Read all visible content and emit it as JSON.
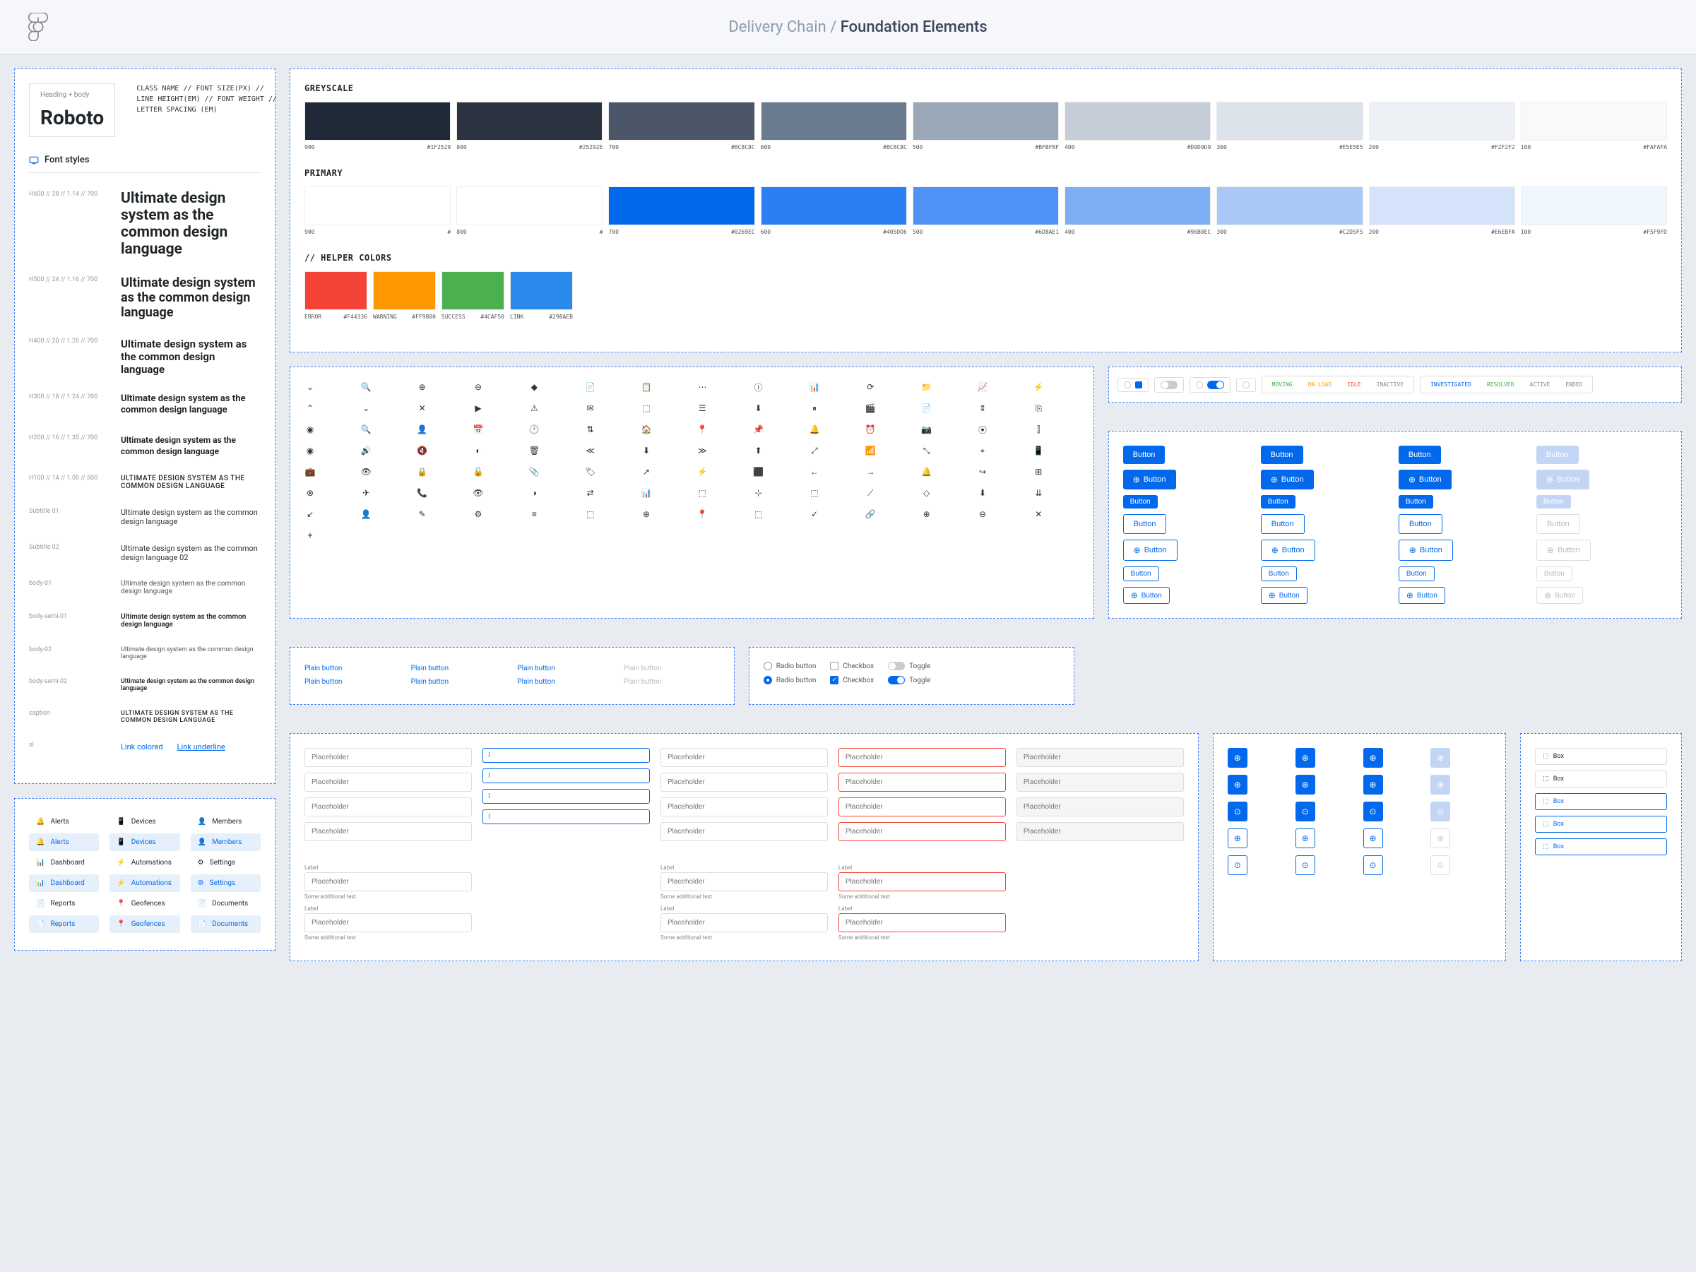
{
  "header": {
    "path": "Delivery Chain /",
    "title": "Foundation Elements"
  },
  "typography": {
    "box_label": "Heading + body",
    "font_name": "Roboto",
    "class_desc": "CLASS NAME // FONT SIZE(PX) //\nLINE HEIGHT(EM) // FONT WEIGHT //\nLETTER SPACING (EM)",
    "section_title": "Font styles",
    "sample": "Ultimate design system as the common design language",
    "sample_caps": "ULTIMATE DESIGN SYSTEM AS THE COMMON DESIGN LANGUAGE",
    "sample2": "Ultimate design system as the common design language 02",
    "styles": [
      {
        "label": "H600 // 28 // 1.14 // 700",
        "cls": "h600"
      },
      {
        "label": "H500 // 24 // 1.16 // 700",
        "cls": "h500"
      },
      {
        "label": "H400 // 20 // 1.20 // 700",
        "cls": "h400"
      },
      {
        "label": "H300 // 18 // 1.24 // 700",
        "cls": "h300"
      },
      {
        "label": "H200 // 16 // 1.35 // 700",
        "cls": "h200"
      },
      {
        "label": "H100 // 14 // 1.00 // 500",
        "cls": "h100"
      },
      {
        "label": "Subtitle 01",
        "cls": "st"
      },
      {
        "label": "Subtitle 02",
        "cls": "st"
      },
      {
        "label": "body-01",
        "cls": "b1"
      },
      {
        "label": "body-semi-01",
        "cls": "b1s"
      },
      {
        "label": "body-02",
        "cls": "b2"
      },
      {
        "label": "body-semi-02",
        "cls": "b2s"
      },
      {
        "label": "caption",
        "cls": "cap"
      }
    ],
    "sl_label": "sl",
    "link1": "Link colored",
    "link2": "Link underline"
  },
  "menu": [
    [
      {
        "icon": "bell",
        "label": "Alerts"
      },
      {
        "icon": "bell",
        "label": "Alerts",
        "on": true
      },
      {
        "icon": "dash",
        "label": "Dashboard"
      },
      {
        "icon": "dash",
        "label": "Dashboard",
        "on": true
      },
      {
        "icon": "doc",
        "label": "Reports"
      },
      {
        "icon": "doc",
        "label": "Reports",
        "on": true
      }
    ],
    [
      {
        "icon": "phone",
        "label": "Devices"
      },
      {
        "icon": "phone",
        "label": "Devices",
        "on": true
      },
      {
        "icon": "auto",
        "label": "Automations"
      },
      {
        "icon": "auto",
        "label": "Automations",
        "on": true
      },
      {
        "icon": "pin",
        "label": "Geofences"
      },
      {
        "icon": "pin",
        "label": "Geofences",
        "on": true
      }
    ],
    [
      {
        "icon": "user",
        "label": "Members"
      },
      {
        "icon": "user",
        "label": "Members",
        "on": true
      },
      {
        "icon": "gear",
        "label": "Settings"
      },
      {
        "icon": "gear",
        "label": "Settings",
        "on": true
      },
      {
        "icon": "doc",
        "label": "Documents"
      },
      {
        "icon": "doc",
        "label": "Documents",
        "on": true
      }
    ]
  ],
  "colors": {
    "greyscale": {
      "title": "GREYSCALE",
      "items": [
        {
          "name": "900",
          "hex": "#1F2529"
        },
        {
          "name": "800",
          "hex": "#25292E"
        },
        {
          "name": "700",
          "hex": "#8C8C8C"
        },
        {
          "name": "600",
          "hex": "#8C8C8C"
        },
        {
          "name": "500",
          "hex": "#BFBFBF"
        },
        {
          "name": "400",
          "hex": "#D9D9D9"
        },
        {
          "name": "300",
          "hex": "#E5E5E5"
        },
        {
          "name": "200",
          "hex": "#F2F2F2"
        },
        {
          "name": "100",
          "hex": "#FAFAFA"
        }
      ],
      "actual": [
        "#1F2937",
        "#2B3341",
        "#4B5768",
        "#6B7B8F",
        "#9AA8B8",
        "#C4CDD8",
        "#DDE3EA",
        "#EDF0F5",
        "#F7F9FB"
      ]
    },
    "primary": {
      "title": "PRIMARY",
      "items": [
        {
          "name": "900",
          "hex": "#"
        },
        {
          "name": "800",
          "hex": "#"
        },
        {
          "name": "700",
          "hex": "#0269EC"
        },
        {
          "name": "600",
          "hex": "#405DD6"
        },
        {
          "name": "500",
          "hex": "#6D8AE1"
        },
        {
          "name": "400",
          "hex": "#96B0EC"
        },
        {
          "name": "300",
          "hex": "#C2D5F5"
        },
        {
          "name": "200",
          "hex": "#E6EBFA"
        },
        {
          "name": "100",
          "hex": "#F5F9FD"
        }
      ],
      "actual": [
        "#FFFFFF",
        "#FFFFFF",
        "#0269EC",
        "#2B7FF5",
        "#4E92F5",
        "#7EAEF3",
        "#A9C8F5",
        "#D4E3FA",
        "#F0F6FE"
      ]
    },
    "helper": {
      "title": "// HELPER COLORS",
      "items": [
        {
          "name": "ERROR",
          "hex": "#F44336"
        },
        {
          "name": "WARNING",
          "hex": "#FF9800"
        },
        {
          "name": "SUCCESS",
          "hex": "#4CAF50"
        },
        {
          "name": "LINK",
          "hex": "#298AEB"
        }
      ]
    }
  },
  "status_tags": [
    {
      "t": "MOVING",
      "c": "#4CAF50"
    },
    {
      "t": "ON LOAD",
      "c": "#FF9800"
    },
    {
      "t": "IDLE",
      "c": "#F44336"
    },
    {
      "t": "INACTIVE",
      "c": "#888"
    }
  ],
  "status_tags2": [
    {
      "t": "INVESTIGATED",
      "c": "#0269EC"
    },
    {
      "t": "RESOLVED",
      "c": "#4CAF50"
    },
    {
      "t": "ACTIVE",
      "c": "#888"
    },
    {
      "t": "ENDED",
      "c": "#888"
    }
  ],
  "button_label": "Button",
  "plain": "Plain button",
  "radio": "Radio button",
  "checkbox": "Checkbox",
  "toggle": "Toggle",
  "placeholder": "Placeholder",
  "ph_i": "I",
  "label": "Label",
  "add_text": "Some additional text",
  "box_label": "Box"
}
